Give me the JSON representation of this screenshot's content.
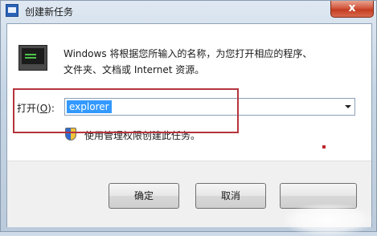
{
  "window": {
    "title": "创建新任务",
    "close_label": "x",
    "app_icon": "task-manager-icon"
  },
  "dialog": {
    "icon": "run-command-icon",
    "description_line1": "Windows 将根据您所输入的名称，为您打开相应的程序、",
    "description_line2": "文件夹、文档或 Internet 资源。",
    "open_label": "打开(",
    "open_accel": "O",
    "open_label_end": "):",
    "input_value": "explorer",
    "admin_icon": "uac-shield-icon",
    "admin_note": "使用管理权限创建此任务。"
  },
  "buttons": {
    "ok": "确定",
    "cancel": "取消",
    "browse": ""
  },
  "annotation": {
    "highlight_color": "#b5343d"
  }
}
